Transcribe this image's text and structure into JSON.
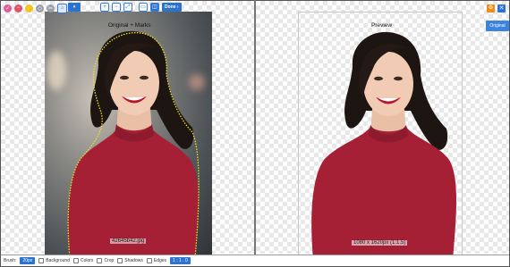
{
  "toolbar": {
    "tools": [
      {
        "icon": "keep-brush-icon",
        "color": "#e05b9c",
        "glyph": "✓"
      },
      {
        "icon": "remove-brush-icon",
        "color": "#e0526a",
        "glyph": "−"
      },
      {
        "icon": "auto-icon",
        "color": "#f2c21a",
        "glyph": "⚡"
      },
      {
        "icon": "eraser-icon",
        "color": "#9aa1a8",
        "glyph": "◇"
      },
      {
        "icon": "scissors-icon",
        "color": "#9aa1a8",
        "glyph": "✂"
      },
      {
        "icon": "home-icon",
        "color": "#3a7bd5",
        "glyph": "⌂"
      }
    ],
    "zoom_label": "▾",
    "zoom_in": "+",
    "zoom_out": "−",
    "zoom_fit": "⤢",
    "view_single": "▭",
    "view_split": "◫",
    "done_label": "Done ›"
  },
  "left_pane": {
    "title": "Original + Marks",
    "filename": "42645b42.jpg"
  },
  "right_pane": {
    "title": "Preview",
    "size": "1080 x 1620px (1:1.5)"
  },
  "side_buttons": {
    "orange_glyph": "⚙",
    "close_glyph": "✕",
    "original_label": "Original"
  },
  "bottom_bar": {
    "brush_label": "Brush:",
    "brush_value": "20px",
    "background_label": "Background",
    "colors_label": "Colors",
    "crop_label": "Crop",
    "shadows_label": "Shadows",
    "edges_label": "Edges",
    "ratio_value": "1 : 1 . 0"
  },
  "colors": {
    "accent": "#2b73d1",
    "shirt": "#a51f35",
    "hair": "#1d1512",
    "marker": "#f0e21a"
  }
}
